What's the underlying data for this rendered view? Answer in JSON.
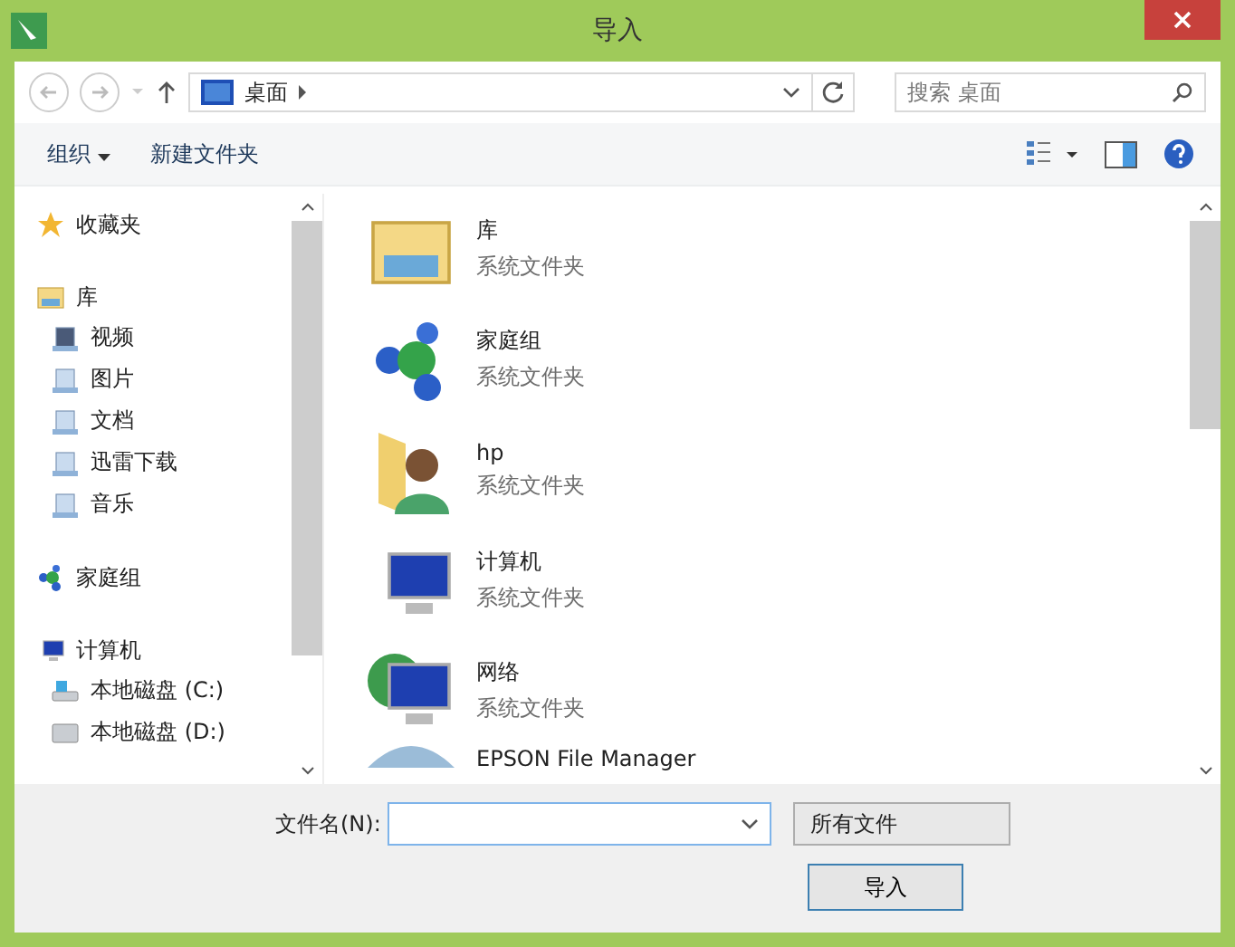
{
  "window": {
    "title": "导入"
  },
  "address_bar": {
    "location": "桌面",
    "search_placeholder": "搜索 桌面"
  },
  "toolbar": {
    "organize": "组织",
    "new_folder": "新建文件夹"
  },
  "navigation": [
    {
      "label": "收藏夹"
    },
    {
      "label": "库",
      "children": [
        {
          "label": "视频"
        },
        {
          "label": "图片"
        },
        {
          "label": "文档"
        },
        {
          "label": "迅雷下载"
        },
        {
          "label": "音乐"
        }
      ]
    },
    {
      "label": "家庭组"
    },
    {
      "label": "计算机",
      "children": [
        {
          "label": "本地磁盘 (C:)"
        },
        {
          "label": "本地磁盘 (D:)"
        }
      ]
    }
  ],
  "items": [
    {
      "name": "库",
      "type": "系统文件夹"
    },
    {
      "name": "家庭组",
      "type": "系统文件夹"
    },
    {
      "name": "hp",
      "type": "系统文件夹"
    },
    {
      "name": "计算机",
      "type": "系统文件夹"
    },
    {
      "name": "网络",
      "type": "系统文件夹"
    },
    {
      "name": "EPSON File Manager"
    }
  ],
  "footer": {
    "file_name_label": "文件名(N):",
    "file_type": "所有文件",
    "buttons": [
      "导入"
    ]
  }
}
